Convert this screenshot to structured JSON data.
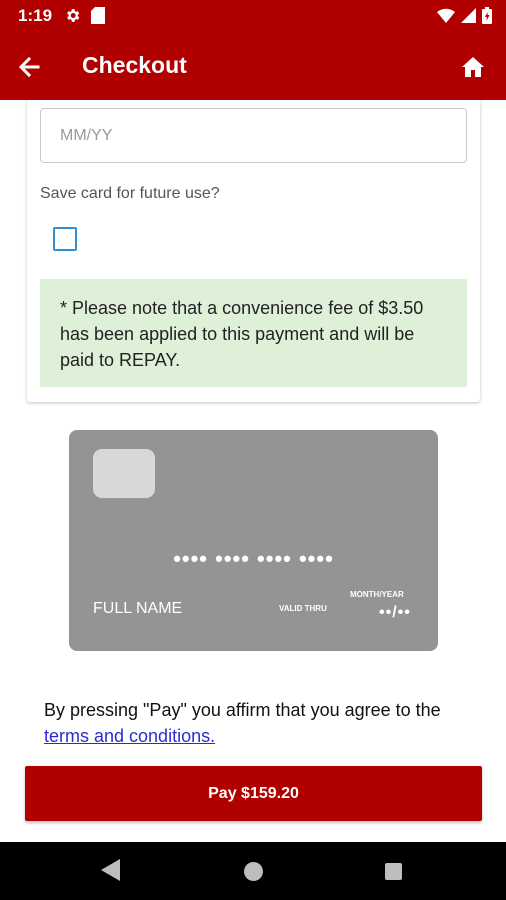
{
  "status_bar": {
    "time": "1:19",
    "left_icons": [
      "gear-icon",
      "sd-card-icon"
    ],
    "right_icons": [
      "wifi-icon",
      "signal-icon",
      "battery-icon"
    ]
  },
  "app_bar": {
    "title": "Checkout",
    "back_icon": "arrow-left-icon",
    "home_icon": "home-icon"
  },
  "form": {
    "expiry_placeholder": "MM/YY",
    "save_card_label": "Save card for future use?",
    "save_card_checked": false,
    "fee_note": "* Please note that a convenience fee of $3.50 has been applied to this payment and will be paid to REPAY."
  },
  "card_preview": {
    "number": "•••• •••• •••• ••••",
    "name": "FULL NAME",
    "valid_thru": "VALID THRU",
    "month_year": "MONTH/YEAR",
    "expiry": "••/••"
  },
  "agreement": {
    "text": "By pressing \"Pay\" you affirm that you agree to the",
    "link": "terms and conditions."
  },
  "pay_button": {
    "label": "Pay $159.20"
  },
  "colors": {
    "brand": "#b00000",
    "note_bg": "#dff0d8",
    "card_bg": "#949494",
    "link": "#2b2bd6",
    "checkbox": "#2f8fd8"
  }
}
